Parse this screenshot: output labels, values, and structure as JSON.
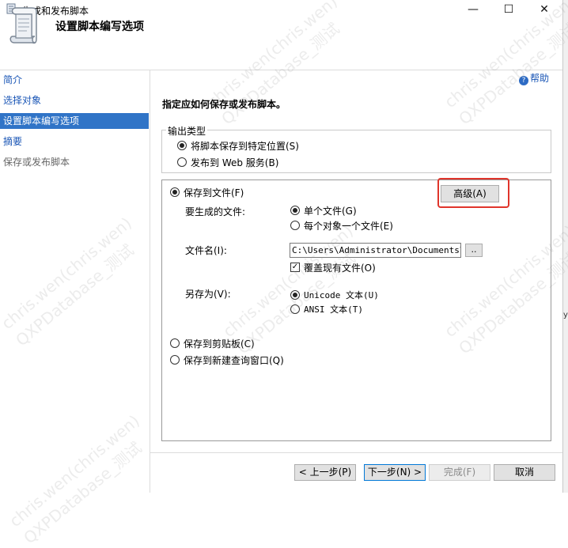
{
  "window": {
    "title": "生成和发布脚本",
    "minimize": "—",
    "maximize": "☐",
    "close": "✕"
  },
  "header": {
    "title": "设置脚本编写选项"
  },
  "sidebar": {
    "items": [
      {
        "label": "简介",
        "state": "link"
      },
      {
        "label": "选择对象",
        "state": "link"
      },
      {
        "label": "设置脚本编写选项",
        "state": "selected"
      },
      {
        "label": "摘要",
        "state": "link"
      },
      {
        "label": "保存或发布脚本",
        "state": "disabled"
      }
    ]
  },
  "help": {
    "label": "帮助"
  },
  "main": {
    "instruction": "指定应如何保存或发布脚本。",
    "output_type": {
      "legend": "输出类型",
      "save_to_location": "将脚本保存到特定位置(S)",
      "publish_web": "发布到 Web 服务(B)"
    },
    "save_to_file": {
      "label": "保存到文件(F)",
      "advanced_button": "高级(A)",
      "files_label": "要生成的文件:",
      "single_file": "单个文件(G)",
      "one_per_object": "每个对象一个文件(E)",
      "filename_label": "文件名(I):",
      "filename_value": "C:\\Users\\Administrator\\Documents\\sc",
      "browse_button": "..",
      "overwrite": "覆盖现有文件(O)",
      "save_as_label": "另存为(V):",
      "unicode": "Unicode 文本(U)",
      "ansi": "ANSI 文本(T)"
    },
    "save_to_clipboard": "保存到剪贴板(C)",
    "save_to_query_window": "保存到新建查询窗口(Q)"
  },
  "footer": {
    "prev": "< 上一步(P)",
    "next": "下一步(N) >",
    "finish": "完成(F)",
    "cancel": "取消"
  },
  "right_edge_fragment": "y",
  "watermark": {
    "line1": "chris.wen(chris.wen)",
    "line2": "QXPDatabase_测试"
  }
}
